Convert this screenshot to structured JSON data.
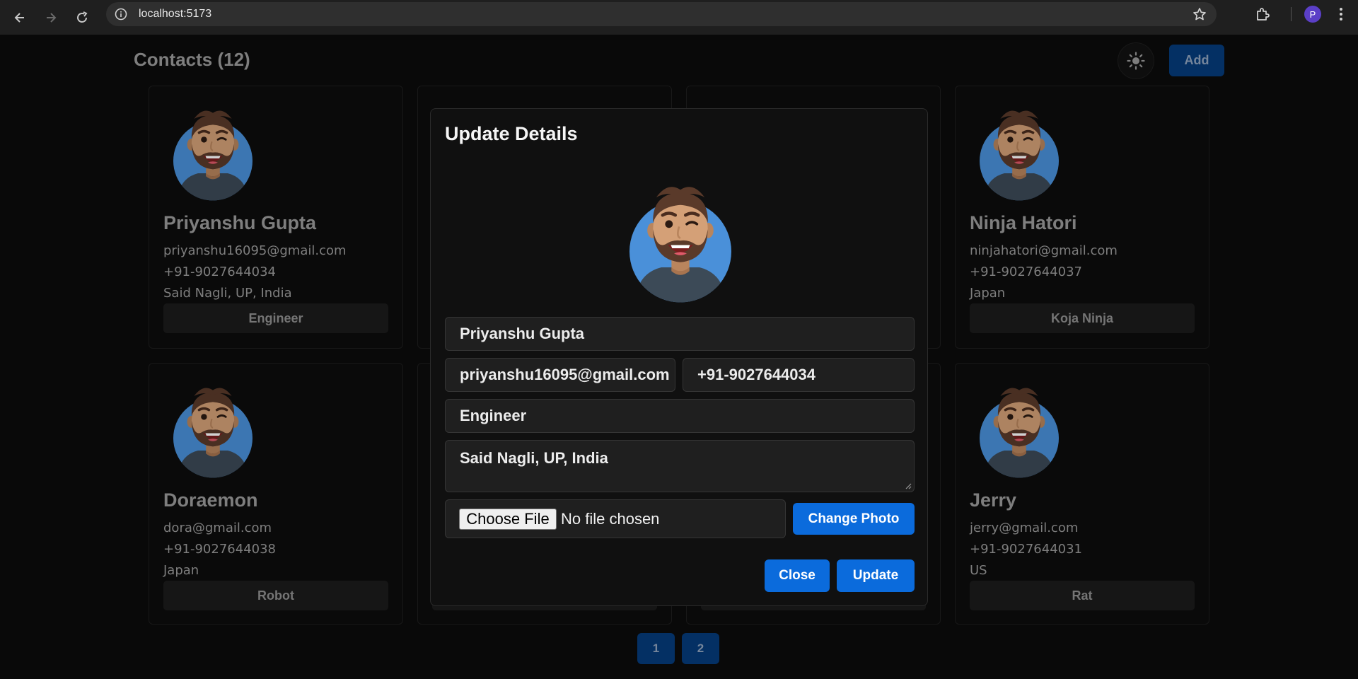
{
  "browser": {
    "url": "localhost:5173",
    "profile_initial": "P"
  },
  "app": {
    "title": "Contacts (12)",
    "add_label": "Add",
    "theme_icon": "sun-icon"
  },
  "cards": [
    {
      "name": "Priyanshu Gupta",
      "email": "priyanshu16095@gmail.com",
      "phone": "+91-9027644034",
      "address": "Said Nagli, UP, India",
      "tag": "Engineer"
    },
    {
      "name": "Ninja Hatori",
      "email": "ninjahatori@gmail.com",
      "phone": "+91-9027644037",
      "address": "Japan",
      "tag": "Koja Ninja"
    },
    {
      "name": "Doraemon",
      "email": "dora@gmail.com",
      "phone": "+91-9027644038",
      "address": "Japan",
      "tag": "Robot"
    },
    {
      "name": "Jerry",
      "email": "jerry@gmail.com",
      "phone": "+91-9027644031",
      "address": "US",
      "tag": "Rat"
    }
  ],
  "pagination": [
    "1",
    "2"
  ],
  "modal": {
    "title": "Update Details",
    "name_value": "Priyanshu Gupta",
    "email_value": "priyanshu16095@gmail.com",
    "phone_value": "+91-9027644034",
    "role_value": "Engineer",
    "address_value": "Said Nagli, UP, India",
    "choose_file_label": "Choose File",
    "no_file_text": "No file chosen",
    "change_photo_label": "Change Photo",
    "close_label": "Close",
    "update_label": "Update"
  },
  "colors": {
    "background": "#0b0b0b",
    "accent_blue": "#0b6bdc",
    "dim_blue": "#063b7a"
  }
}
